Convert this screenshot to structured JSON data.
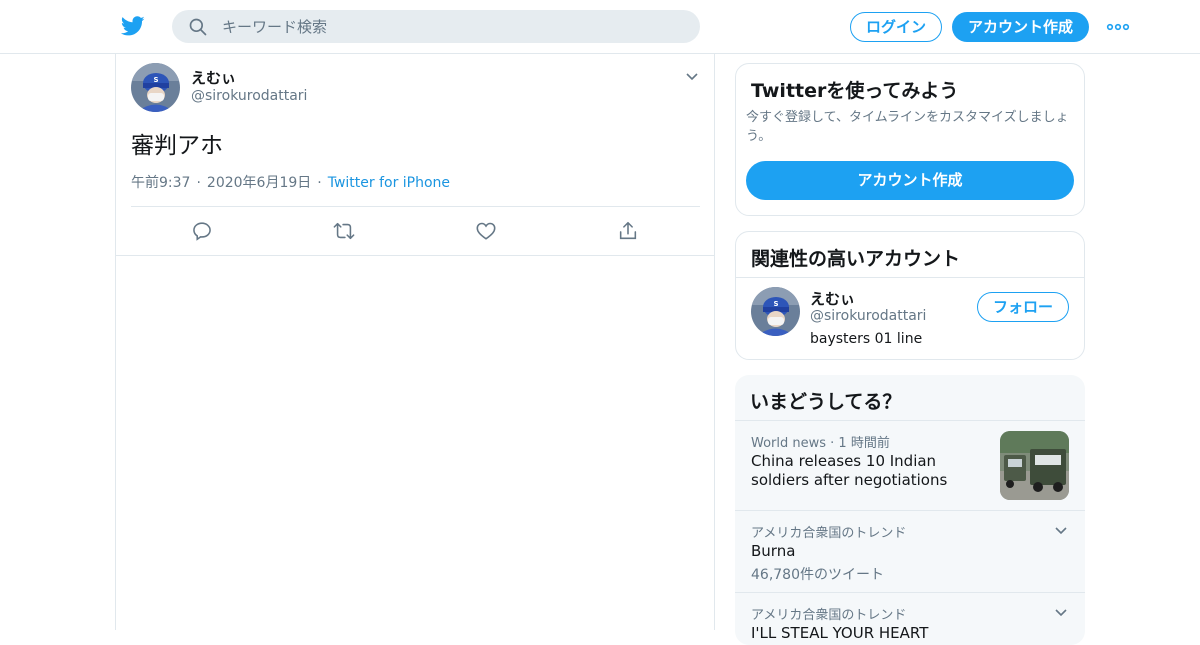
{
  "header": {
    "search_placeholder": "キーワード検索",
    "login_label": "ログイン",
    "signup_label": "アカウント作成"
  },
  "tweet": {
    "name": "えむぃ",
    "handle": "@sirokurodattari",
    "text": "審判アホ",
    "time": "午前9:37",
    "date": "2020年6月19日",
    "source": "Twitter for iPhone",
    "separator": "·"
  },
  "signup_card": {
    "title": "Twitterを使ってみよう",
    "description": "今すぐ登録して、タイムラインをカスタマイズしましょう。",
    "button_label": "アカウント作成"
  },
  "related_card": {
    "title": "関連性の高いアカウント",
    "account": {
      "name": "えむぃ",
      "handle": "@sirokurodattari",
      "bio": "baysters 01 line",
      "follow_label": "フォロー"
    }
  },
  "trends_card": {
    "title": "いまどうしてる？",
    "trends": [
      {
        "meta": "World news · 1 時間前",
        "title": "China releases 10 Indian soldiers after negotiations",
        "count": ""
      },
      {
        "meta": "アメリカ合衆国のトレンド",
        "title": "Burna",
        "count": "46,780件のツイート"
      },
      {
        "meta": "アメリカ合衆国のトレンド",
        "title": "I'LL STEAL YOUR HEART",
        "count": ""
      }
    ]
  },
  "colors": {
    "accent": "#1da1f2",
    "link": "#1b95e0",
    "secondary_text": "#657786",
    "border": "#e1e8ed",
    "trends_bg": "#f5f8fa"
  },
  "icons": [
    "twitter-bird-icon",
    "search-icon",
    "more-icon",
    "chevron-down-icon",
    "reply-icon",
    "retweet-icon",
    "like-icon",
    "share-icon"
  ]
}
